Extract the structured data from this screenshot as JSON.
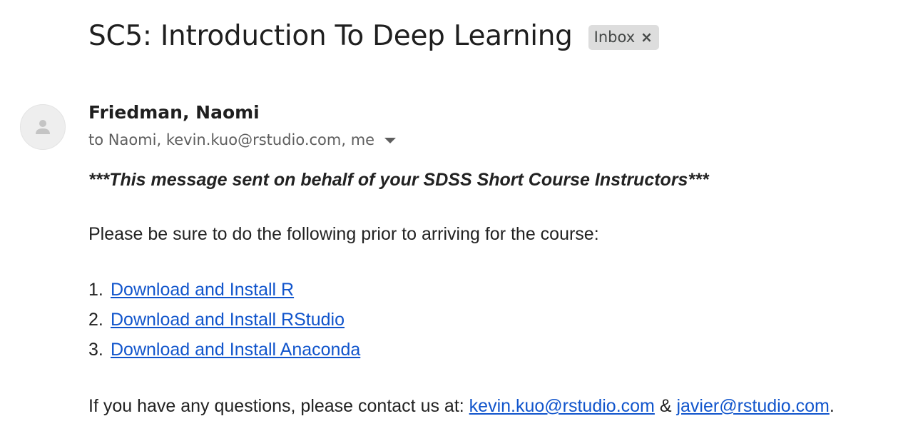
{
  "email": {
    "subject": "SC5: Introduction To Deep Learning",
    "label": {
      "text": "Inbox",
      "remove_symbol": "×"
    },
    "sender": {
      "name": "Friedman, Naomi",
      "avatar_icon": "default-person-icon"
    },
    "recipients": "to Naomi, kevin.kuo@rstudio.com, me",
    "body": {
      "intro_note": "***This message sent on behalf of your SDSS Short Course Instructors***",
      "instruction": "Please be sure to do the following prior to arriving for the course:",
      "steps": [
        {
          "number": "1.",
          "link_text": "Download and Install R"
        },
        {
          "number": "2.",
          "link_text": "Download and Install RStudio"
        },
        {
          "number": "3.",
          "link_text": "Download and Install Anaconda"
        }
      ],
      "contact": {
        "prefix": "If you have any questions, please contact us at: ",
        "email_1": "kevin.kuo@rstudio.com",
        "separator": " & ",
        "email_2": "javier@rstudio.com",
        "suffix": "."
      }
    }
  },
  "colors": {
    "link": "#1155cc",
    "chip_background": "#dddddd",
    "secondary_text": "#5e5e5e"
  }
}
